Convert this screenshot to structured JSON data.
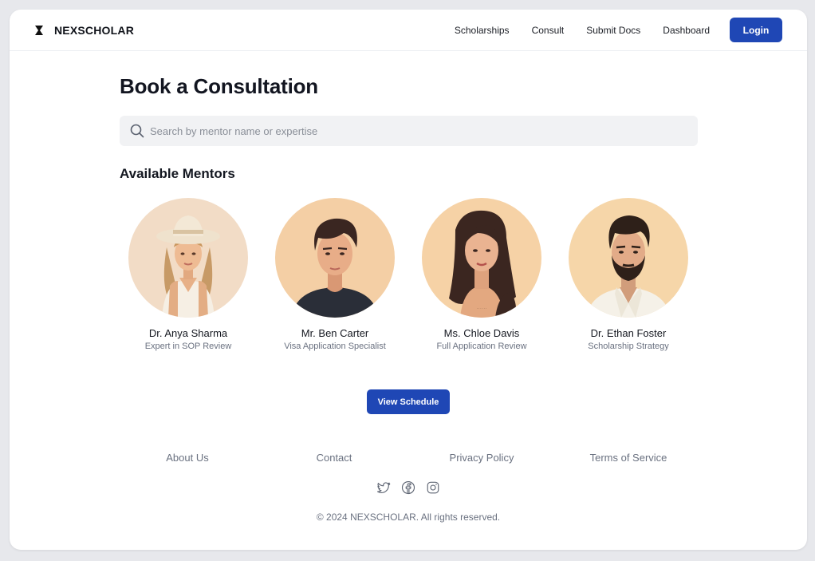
{
  "brand": {
    "name": "NEXSCHOLAR"
  },
  "nav": {
    "items": [
      "Scholarships",
      "Consult",
      "Submit Docs",
      "Dashboard"
    ],
    "login_label": "Login"
  },
  "page": {
    "title": "Book a Consultation"
  },
  "search": {
    "placeholder": "Search by mentor name or expertise",
    "value": ""
  },
  "mentors_section": {
    "title": "Available Mentors",
    "mentors": [
      {
        "name": "Dr. Anya Sharma",
        "role": "Expert in SOP Review"
      },
      {
        "name": "Mr. Ben Carter",
        "role": "Visa Application Specialist"
      },
      {
        "name": "Ms. Chloe Davis",
        "role": "Full Application Review"
      },
      {
        "name": "Dr. Ethan Foster",
        "role": "Scholarship Strategy"
      }
    ],
    "cta_label": "View Schedule"
  },
  "footer": {
    "links": [
      "About Us",
      "Contact",
      "Privacy Policy",
      "Terms of Service"
    ],
    "social_icons": [
      "twitter-icon",
      "facebook-icon",
      "instagram-icon"
    ],
    "copyright": "© 2024 NEXSCHOLAR. All rights reserved."
  },
  "colors": {
    "primary": "#1f47b5",
    "background": "#e7e8ec",
    "card": "#ffffff",
    "muted_text": "#6a7180",
    "search_bg": "#f1f2f4",
    "avatar_bg": "#f4d3ae"
  }
}
